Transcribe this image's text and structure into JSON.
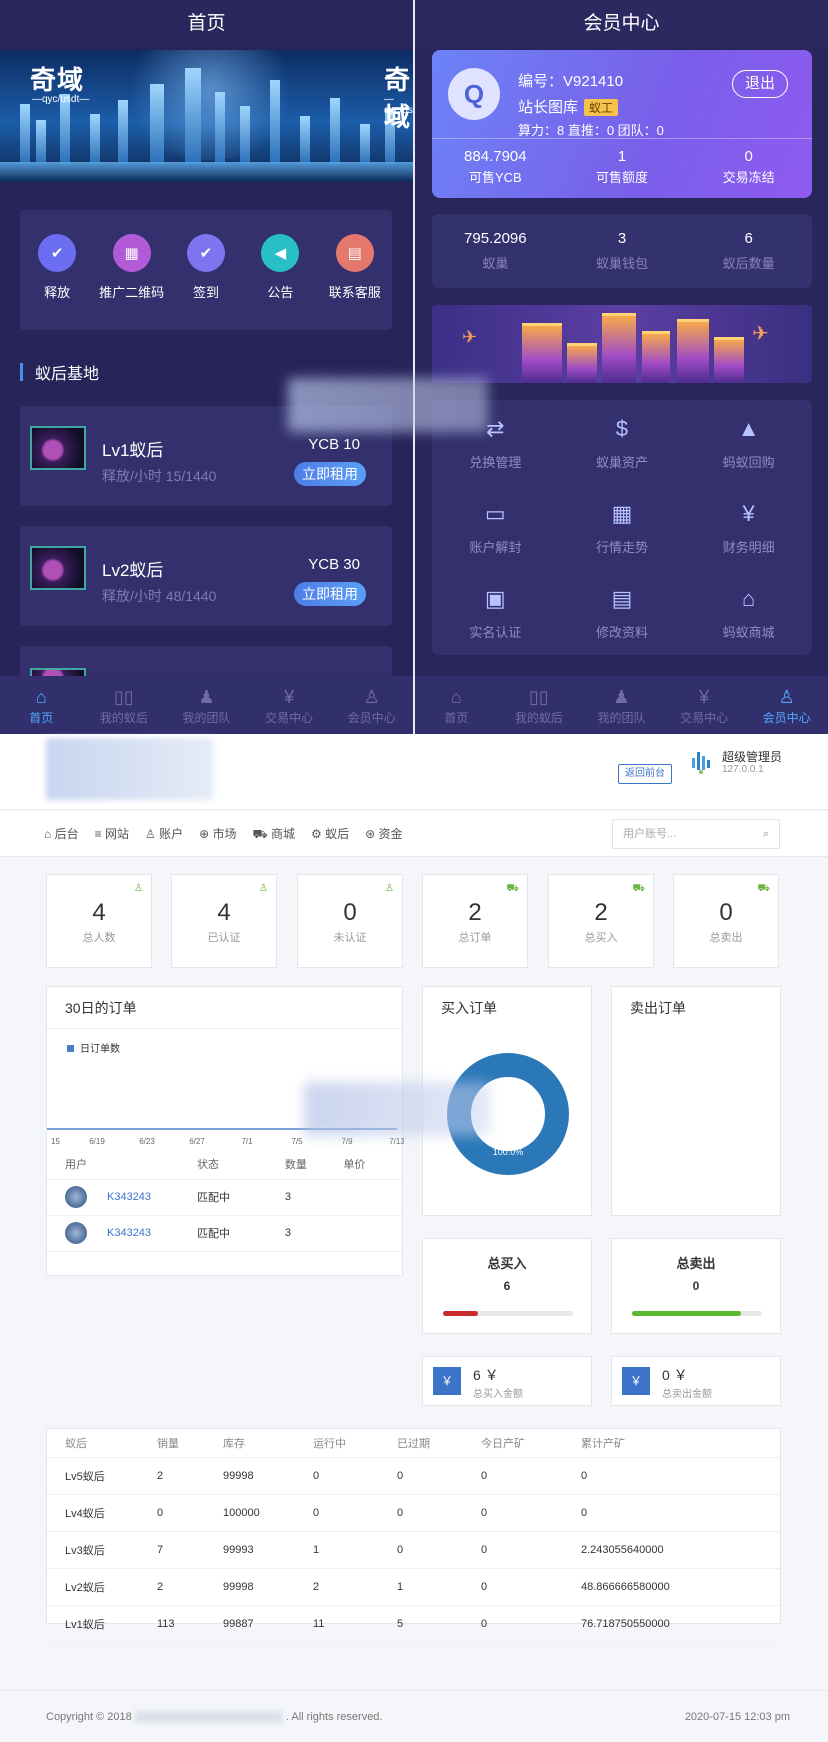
{
  "home": {
    "title": "首页",
    "banner": {
      "logo": "奇域",
      "sub": "—qyc/usdt—"
    },
    "quick": [
      {
        "label": "释放",
        "icon": "release-icon",
        "glyph": "✔",
        "color": "#6b6ef0"
      },
      {
        "label": "推广二维码",
        "icon": "qrcode-icon",
        "glyph": "▦",
        "color": "#b25bd9"
      },
      {
        "label": "签到",
        "icon": "checkin-icon",
        "glyph": "✔",
        "color": "#7d74ef"
      },
      {
        "label": "公告",
        "icon": "announcement-icon",
        "glyph": "◀",
        "color": "#28bfc7"
      },
      {
        "label": "联系客服",
        "icon": "service-icon",
        "glyph": "▤",
        "color": "#e4786c"
      }
    ],
    "section_title": "蚁后基地",
    "cards": [
      {
        "name": "Lv1蚁后",
        "sub": "释放/小时 15/1440",
        "price": "YCB 10",
        "button": "立即租用"
      },
      {
        "name": "Lv2蚁后",
        "sub": "释放/小时 48/1440",
        "price": "YCB 30",
        "button": "立即租用"
      }
    ],
    "tabs": [
      {
        "label": "首页",
        "glyph": "⌂",
        "active": true
      },
      {
        "label": "我的蚁后",
        "glyph": "▯▯",
        "active": false
      },
      {
        "label": "我的团队",
        "glyph": "♟",
        "active": false
      },
      {
        "label": "交易中心",
        "glyph": "¥",
        "active": false
      },
      {
        "label": "会员中心",
        "glyph": "♙",
        "active": false
      }
    ]
  },
  "member": {
    "title": "会员中心",
    "id_text": "编号：V921410",
    "name": "站长图库",
    "badge": "蚁工",
    "meta": "算力：8        直推：0 团队：0",
    "logout": "退出",
    "stats": [
      {
        "value": "884.7904",
        "label": "可售YCB"
      },
      {
        "value": "1",
        "label": "可售额度"
      },
      {
        "value": "0",
        "label": "交易冻结"
      }
    ],
    "stats2": [
      {
        "value": "795.2096",
        "label": "蚁巢"
      },
      {
        "value": "3",
        "label": "蚁巢钱包"
      },
      {
        "value": "6",
        "label": "蚁后数量"
      }
    ],
    "grid": [
      {
        "label": "兑换管理",
        "icon": "exchange-icon",
        "glyph": "⇄"
      },
      {
        "label": "蚁巢资产",
        "icon": "money-bag-icon",
        "glyph": "$"
      },
      {
        "label": "蚂蚁回购",
        "icon": "recycle-icon",
        "glyph": "▲"
      },
      {
        "label": "账户解封",
        "icon": "card-icon",
        "glyph": "▭"
      },
      {
        "label": "行情走势",
        "icon": "gift-icon",
        "glyph": "▦"
      },
      {
        "label": "财务明细",
        "icon": "finance-icon",
        "glyph": "¥"
      },
      {
        "label": "实名认证",
        "icon": "id-card-icon",
        "glyph": "▣"
      },
      {
        "label": "修改资料",
        "icon": "edit-doc-icon",
        "glyph": "▤"
      },
      {
        "label": "蚂蚁商城",
        "icon": "store-icon",
        "glyph": "⌂"
      }
    ],
    "tabs": [
      {
        "label": "首页",
        "glyph": "⌂",
        "active": false
      },
      {
        "label": "我的蚁后",
        "glyph": "▯▯",
        "active": false
      },
      {
        "label": "我的团队",
        "glyph": "♟",
        "active": false
      },
      {
        "label": "交易中心",
        "glyph": "¥",
        "active": false
      },
      {
        "label": "会员中心",
        "glyph": "♙",
        "active": true
      }
    ]
  },
  "admin": {
    "back_label": "返回前台",
    "user_name": "超级管理员",
    "user_ip": "127.0.0.1",
    "nav": [
      {
        "label": "后台",
        "glyph": "⌂"
      },
      {
        "label": "网站",
        "glyph": "≡"
      },
      {
        "label": "账户",
        "glyph": "♙"
      },
      {
        "label": "市场",
        "glyph": "⊕"
      },
      {
        "label": "商城",
        "glyph": "⛟"
      },
      {
        "label": "蚁后",
        "glyph": "⚙"
      },
      {
        "label": "资金",
        "glyph": "⊛"
      }
    ],
    "search_placeholder": "用户账号...",
    "stats": [
      {
        "value": "4",
        "label": "总人数",
        "glyph": "♙"
      },
      {
        "value": "4",
        "label": "已认证",
        "glyph": "♙"
      },
      {
        "value": "0",
        "label": "未认证",
        "glyph": "♙"
      },
      {
        "value": "2",
        "label": "总订单",
        "glyph": "⛟"
      },
      {
        "value": "2",
        "label": "总买入",
        "glyph": "⛟"
      },
      {
        "value": "0",
        "label": "总卖出",
        "glyph": "⛟"
      }
    ],
    "orders_panel_title": "30日的订单",
    "orders_table": {
      "headers": [
        "用户",
        "状态",
        "数量",
        "单价"
      ],
      "rows": [
        {
          "user": "K343243",
          "status": "匹配中",
          "qty": "3"
        },
        {
          "user": "K343243",
          "status": "匹配中",
          "qty": "3"
        }
      ]
    },
    "buy_panel_title": "买入订单",
    "sell_panel_title": "卖出订单",
    "total_buy": {
      "title": "总买入",
      "value": "6",
      "fill": 0.27
    },
    "total_sell": {
      "title": "总卖出",
      "value": "0",
      "fill": 0.84
    },
    "buy_money": {
      "value": "6 ￥",
      "label": "总买入金额",
      "glyph": "￥"
    },
    "sell_money": {
      "value": "0 ￥",
      "label": "总卖出金额",
      "glyph": "￥"
    },
    "ant_table": {
      "headers": [
        "蚁后",
        "销量",
        "库存",
        "运行中",
        "已过期",
        "今日产矿",
        "累计产矿"
      ],
      "rows": [
        [
          "Lv5蚁后",
          "2",
          "99998",
          "0",
          "0",
          "0",
          "0"
        ],
        [
          "Lv4蚁后",
          "0",
          "100000",
          "0",
          "0",
          "0",
          "0"
        ],
        [
          "Lv3蚁后",
          "7",
          "99993",
          "1",
          "0",
          "0",
          "2.243055640000"
        ],
        [
          "Lv2蚁后",
          "2",
          "99998",
          "2",
          "1",
          "0",
          "48.866666580000"
        ],
        [
          "Lv1蚁后",
          "113",
          "99887",
          "11",
          "5",
          "0",
          "76.718750550000"
        ]
      ]
    },
    "footer_left_prefix": "Copyright © 2018",
    "footer_left_suffix": ". All rights reserved.",
    "footer_right": "2020-07-15 12:03 pm"
  },
  "chart_data": [
    {
      "type": "line",
      "title": "30日的订单",
      "series": [
        {
          "name": "日订单数",
          "color": "#4a7fc8",
          "values": [
            0,
            0,
            0,
            0,
            0,
            0,
            0,
            0
          ]
        }
      ],
      "x": [
        "15",
        "6/19",
        "6/23",
        "6/27",
        "7/1",
        "7/5",
        "7/9",
        "7/13"
      ]
    },
    {
      "type": "pie",
      "title": "买入订单",
      "slices": [
        {
          "label": "100.0%",
          "value": 100.0,
          "color": "#2b78b8"
        }
      ],
      "donut": true
    }
  ]
}
